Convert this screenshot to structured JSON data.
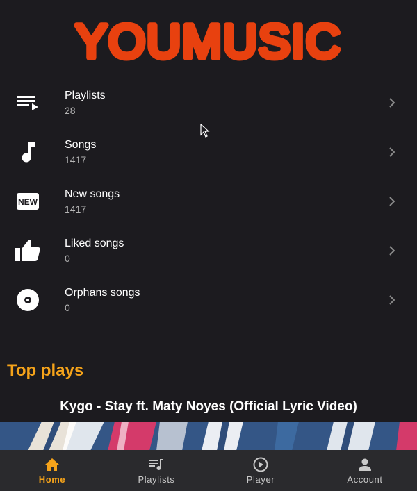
{
  "app": {
    "logo_text": "YOUMUSIC"
  },
  "menu": [
    {
      "title": "Playlists",
      "count": "28",
      "icon": "playlist-play-icon"
    },
    {
      "title": "Songs",
      "count": "1417",
      "icon": "music-note-icon"
    },
    {
      "title": "New songs",
      "count": "1417",
      "icon": "new-badge-icon"
    },
    {
      "title": "Liked songs",
      "count": "0",
      "icon": "thumb-up-icon"
    },
    {
      "title": "Orphans songs",
      "count": "0",
      "icon": "disc-icon"
    }
  ],
  "top_plays": {
    "heading": "Top plays",
    "video_title": "Kygo - Stay ft. Maty Noyes (Official Lyric Video)"
  },
  "bottom_nav": [
    {
      "label": "Home",
      "icon": "home-icon",
      "active": true
    },
    {
      "label": "Playlists",
      "icon": "queue-music-icon",
      "active": false
    },
    {
      "label": "Player",
      "icon": "play-circle-icon",
      "active": false
    },
    {
      "label": "Account",
      "icon": "account-icon",
      "active": false
    }
  ],
  "colors": {
    "background": "#1c1b1f",
    "logo": "#e8410f",
    "accent": "#f5a31a",
    "nav_background": "#2a2a2d"
  }
}
